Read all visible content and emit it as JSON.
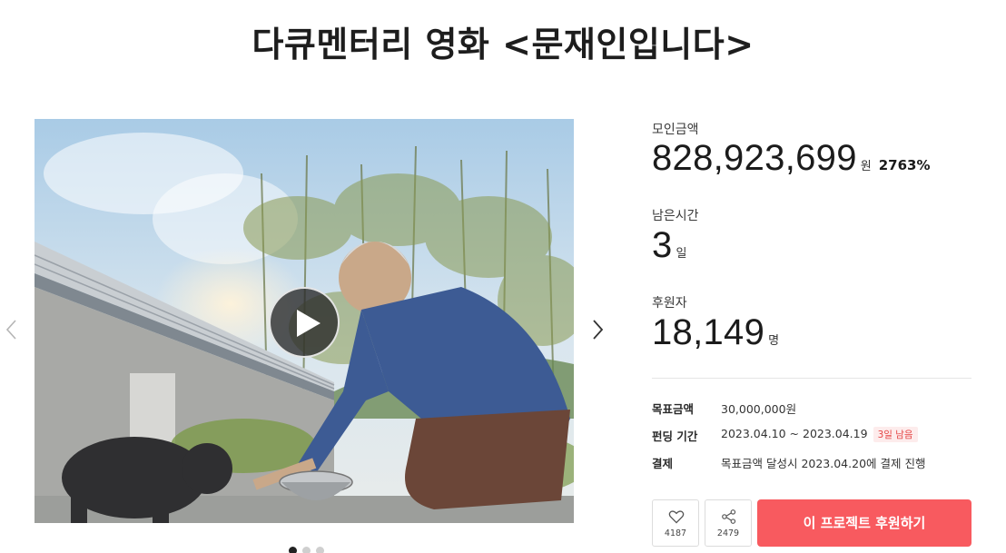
{
  "page": {
    "title": "다큐멘터리 영화 <문재인입니다>"
  },
  "funding": {
    "amount_label": "모인금액",
    "amount_value": "828,923,699",
    "amount_unit": "원",
    "percent": "2763%",
    "remaining_label": "남은시간",
    "remaining_value": "3",
    "remaining_unit": "일",
    "supporters_label": "후원자",
    "supporters_value": "18,149",
    "supporters_unit": "명"
  },
  "details": {
    "goal_key": "목표금액",
    "goal_value": "30,000,000원",
    "period_key": "펀딩 기간",
    "period_value": "2023.04.10 ~ 2023.04.19",
    "period_badge": "3일 남음",
    "payment_key": "결제",
    "payment_value": "목표금액 달성시 2023.04.20에 결제 진행"
  },
  "actions": {
    "like_count": "4187",
    "share_count": "2479",
    "support_label": "이 프로젝트 후원하기"
  },
  "icons": {
    "play": "play-icon",
    "prev": "chevron-left-icon",
    "next": "chevron-right-icon",
    "like": "heart-icon",
    "share": "share-icon"
  },
  "colors": {
    "accent": "#f85a5f",
    "badge_text": "#e54545",
    "badge_bg": "#fdecec"
  },
  "carousel": {
    "slides": 3,
    "active": 1
  }
}
